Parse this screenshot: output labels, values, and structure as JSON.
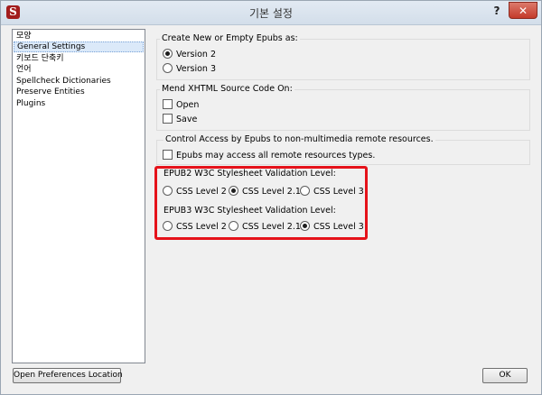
{
  "window": {
    "title": "기본 설정",
    "app_icon_glyph": "S",
    "help_label": "?",
    "close_label": "✕"
  },
  "categories": [
    {
      "label": "모양",
      "selected": false
    },
    {
      "label": "General Settings",
      "selected": true
    },
    {
      "label": "키보드 단축키",
      "selected": false
    },
    {
      "label": "언어",
      "selected": false
    },
    {
      "label": "Spellcheck Dictionaries",
      "selected": false
    },
    {
      "label": "Preserve Entities",
      "selected": false
    },
    {
      "label": "Plugins",
      "selected": false
    }
  ],
  "new_epub": {
    "label": "Create New or Empty Epubs as:",
    "options": [
      {
        "label": "Version 2",
        "checked": true
      },
      {
        "label": "Version 3",
        "checked": false
      }
    ]
  },
  "mend": {
    "label": "Mend XHTML Source Code On:",
    "options": [
      {
        "label": "Open",
        "checked": false
      },
      {
        "label": "Save",
        "checked": false
      }
    ]
  },
  "remote": {
    "label": "Control Access by Epubs to non-multimedia remote resources.",
    "option": {
      "label": "Epubs may access all remote resources types.",
      "checked": false
    }
  },
  "epub2_validation": {
    "label": "EPUB2 W3C Stylesheet Validation Level:",
    "options": [
      {
        "label": "CSS Level 2",
        "checked": false
      },
      {
        "label": "CSS Level 2.1",
        "checked": true
      },
      {
        "label": "CSS Level 3",
        "checked": false
      }
    ]
  },
  "epub3_validation": {
    "label": "EPUB3 W3C Stylesheet Validation Level:",
    "options": [
      {
        "label": "CSS Level 2",
        "checked": false
      },
      {
        "label": "CSS Level 2.1",
        "checked": false
      },
      {
        "label": "CSS Level 3",
        "checked": true
      }
    ]
  },
  "buttons": {
    "open_prefs": "Open Preferences Location",
    "ok": "OK"
  },
  "colors": {
    "highlight_border": "#e5121a",
    "selected_item": "#dbe9f9",
    "close_button": "#c43a2a"
  }
}
